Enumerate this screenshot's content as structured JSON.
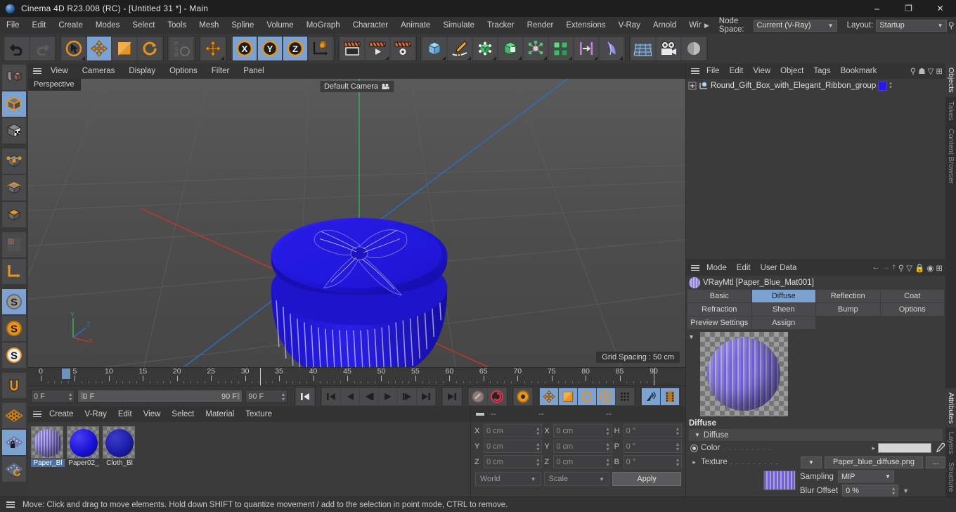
{
  "window": {
    "title": "Cinema 4D R23.008 (RC) - [Untitled 31 *] - Main",
    "minimize": "–",
    "maximize": "❐",
    "close": "✕"
  },
  "menubar": {
    "items": [
      "File",
      "Edit",
      "Create",
      "Modes",
      "Select",
      "Tools",
      "Mesh",
      "Spline",
      "Volume",
      "MoGraph",
      "Character",
      "Animate",
      "Simulate",
      "Tracker",
      "Render",
      "Extensions",
      "V-Ray",
      "Arnold",
      "Wind"
    ],
    "overflow_arrow": "▶",
    "node_space_label": "Node Space:",
    "node_space_value": "Current (V-Ray)",
    "layout_label": "Layout:",
    "layout_value": "Startup",
    "search_icon": "search-icon"
  },
  "viewport": {
    "menu": [
      "View",
      "Cameras",
      "Display",
      "Options",
      "Filter",
      "Panel"
    ],
    "label": "Perspective",
    "camera": "Default Camera",
    "grid_spacing": "Grid Spacing : 50 cm",
    "axis_x": "X",
    "axis_y": "Y",
    "axis_z": "Z"
  },
  "timeline": {
    "ticks": [
      0,
      5,
      10,
      15,
      20,
      25,
      30,
      35,
      40,
      45,
      50,
      55,
      60,
      65,
      70,
      75,
      80,
      85,
      90
    ],
    "current_frame": "0 F",
    "range_start": "0 F",
    "range_end": "90 F",
    "end_frame": "90 F",
    "preview_frame": "0 F",
    "transport": [
      "go-to-start",
      "previous-key",
      "previous-frame",
      "play",
      "next-frame",
      "next-key",
      "go-to-end"
    ],
    "record_buttons": [
      "autokey",
      "record"
    ],
    "key_toggles": [
      "position",
      "scale",
      "rotation",
      "parameter",
      "point-level"
    ]
  },
  "material_manager": {
    "menu": [
      "Create",
      "V-Ray",
      "Edit",
      "View",
      "Select",
      "Material",
      "Texture"
    ],
    "materials": [
      {
        "name": "Paper_Bl",
        "selected": true,
        "color": "#7c6fd4",
        "type": "striped"
      },
      {
        "name": "Paper02_",
        "selected": false,
        "color": "#1a12d6",
        "type": "solid"
      },
      {
        "name": "Cloth_Bl",
        "selected": false,
        "color": "#1c1ea8",
        "type": "cloth"
      }
    ]
  },
  "coordinates": {
    "header": [
      "--",
      "--",
      "--"
    ],
    "position_label": "X",
    "rows": [
      {
        "l1": "X",
        "v1": "0 cm",
        "l2": "X",
        "v2": "0 cm",
        "l3": "H",
        "v3": "0 °"
      },
      {
        "l1": "Y",
        "v1": "0 cm",
        "l2": "Y",
        "v2": "0 cm",
        "l3": "P",
        "v3": "0 °"
      },
      {
        "l1": "Z",
        "v1": "0 cm",
        "l2": "Z",
        "v2": "0 cm",
        "l3": "B",
        "v3": "0 °"
      }
    ],
    "system": "World",
    "mode": "Scale",
    "apply": "Apply"
  },
  "object_manager": {
    "menu": [
      "File",
      "Edit",
      "View",
      "Object",
      "Tags",
      "Bookmarks"
    ],
    "object_name": "Round_Gift_Box_with_Elegant_Ribbon_group",
    "tag_color": "#2b17e8"
  },
  "attributes": {
    "menu": [
      "Mode",
      "Edit",
      "User Data"
    ],
    "title": "VRayMtl [Paper_Blue_Mat001]",
    "tabs": [
      {
        "label": "Basic",
        "selected": false
      },
      {
        "label": "Diffuse",
        "selected": true
      },
      {
        "label": "Reflection",
        "selected": false
      },
      {
        "label": "Coat",
        "selected": false
      },
      {
        "label": "Refraction",
        "selected": false
      },
      {
        "label": "Sheen",
        "selected": false
      },
      {
        "label": "Bump",
        "selected": false
      },
      {
        "label": "Options",
        "selected": false
      },
      {
        "label": "Preview Settings",
        "selected": false
      },
      {
        "label": "Assign",
        "selected": false
      }
    ],
    "section_title": "Diffuse",
    "group_label": "Diffuse",
    "color_label": "Color",
    "color_value": "#d6d6d6",
    "texture_label": "Texture",
    "texture_value": "Paper_blue_diffuse.png",
    "texture_browse": "...",
    "sampling_label": "Sampling",
    "sampling_value": "MIP",
    "blur_label": "Blur Offset",
    "blur_value": "0 %"
  },
  "vertical_tabs_top": [
    "Objects",
    "Takes",
    "Content Browser"
  ],
  "vertical_tabs_bottom": [
    "Attributes",
    "Layers",
    "Structure"
  ],
  "statusbar": {
    "text": "Move: Click and drag to move elements. Hold down SHIFT to quantize movement / add to the selection in point mode, CTRL to remove."
  },
  "toolbar": {
    "groups": [
      {
        "name": "undo-redo",
        "buttons": [
          {
            "icon": "undo-icon",
            "selected": false
          },
          {
            "icon": "redo-icon",
            "selected": false
          }
        ]
      },
      {
        "name": "transform",
        "buttons": [
          {
            "icon": "select-live-icon",
            "selected": false
          },
          {
            "icon": "move-icon",
            "selected": true
          },
          {
            "icon": "scale-icon",
            "selected": false
          },
          {
            "icon": "rotate-icon",
            "selected": false
          }
        ]
      },
      {
        "name": "psr",
        "buttons": [
          {
            "icon": "psr-icon",
            "selected": false
          }
        ]
      },
      {
        "name": "world-axis",
        "buttons": [
          {
            "icon": "move-world-icon",
            "selected": false
          }
        ]
      },
      {
        "name": "axis-locks",
        "buttons": [
          {
            "icon": "x-axis-icon",
            "selected": true
          },
          {
            "icon": "y-axis-icon",
            "selected": true
          },
          {
            "icon": "z-axis-icon",
            "selected": true
          },
          {
            "icon": "object-world-icon",
            "selected": false
          }
        ]
      },
      {
        "name": "render",
        "buttons": [
          {
            "icon": "render-view-icon",
            "selected": false
          },
          {
            "icon": "render-queue-icon",
            "selected": false
          },
          {
            "icon": "render-settings-icon",
            "selected": false
          }
        ]
      },
      {
        "name": "objects",
        "buttons": [
          {
            "icon": "cube-primitive-icon",
            "selected": false
          },
          {
            "icon": "pen-spline-icon",
            "selected": false
          },
          {
            "icon": "generator-icon",
            "selected": false
          },
          {
            "icon": "boole-icon",
            "selected": false
          },
          {
            "icon": "deformer-icon",
            "selected": false
          },
          {
            "icon": "mograph-cloner-icon",
            "selected": false
          },
          {
            "icon": "field-icon",
            "selected": false
          },
          {
            "icon": "light-icon",
            "selected": false
          }
        ]
      },
      {
        "name": "scene",
        "buttons": [
          {
            "icon": "floor-icon",
            "selected": false
          },
          {
            "icon": "camera-icon",
            "selected": false
          },
          {
            "icon": "light-object-icon",
            "selected": false
          }
        ]
      }
    ]
  },
  "left_toolbar": {
    "buttons": [
      {
        "icon": "make-editable-icon",
        "selected": false
      },
      {
        "icon": "model-mode-icon",
        "selected": true
      },
      {
        "icon": "texture-mode-icon",
        "selected": false
      },
      {
        "icon": "point-mode-icon",
        "selected": false
      },
      {
        "icon": "edge-mode-icon",
        "selected": false
      },
      {
        "icon": "polygon-mode-icon",
        "selected": false
      },
      {
        "icon": "uv-mode-icon",
        "selected": false
      },
      {
        "icon": "axis-mode-icon",
        "selected": false
      },
      {
        "icon": "enable-axis-icon",
        "selected": true
      },
      {
        "icon": "object-axis-icon",
        "selected": false
      },
      {
        "icon": "world-axis-s-icon",
        "selected": false
      },
      {
        "icon": "snap-icon",
        "selected": false
      },
      {
        "icon": "workplane-icon",
        "selected": false
      },
      {
        "icon": "lock-workplane-icon",
        "selected": true
      },
      {
        "icon": "planar-workplane-icon",
        "selected": false
      }
    ]
  }
}
